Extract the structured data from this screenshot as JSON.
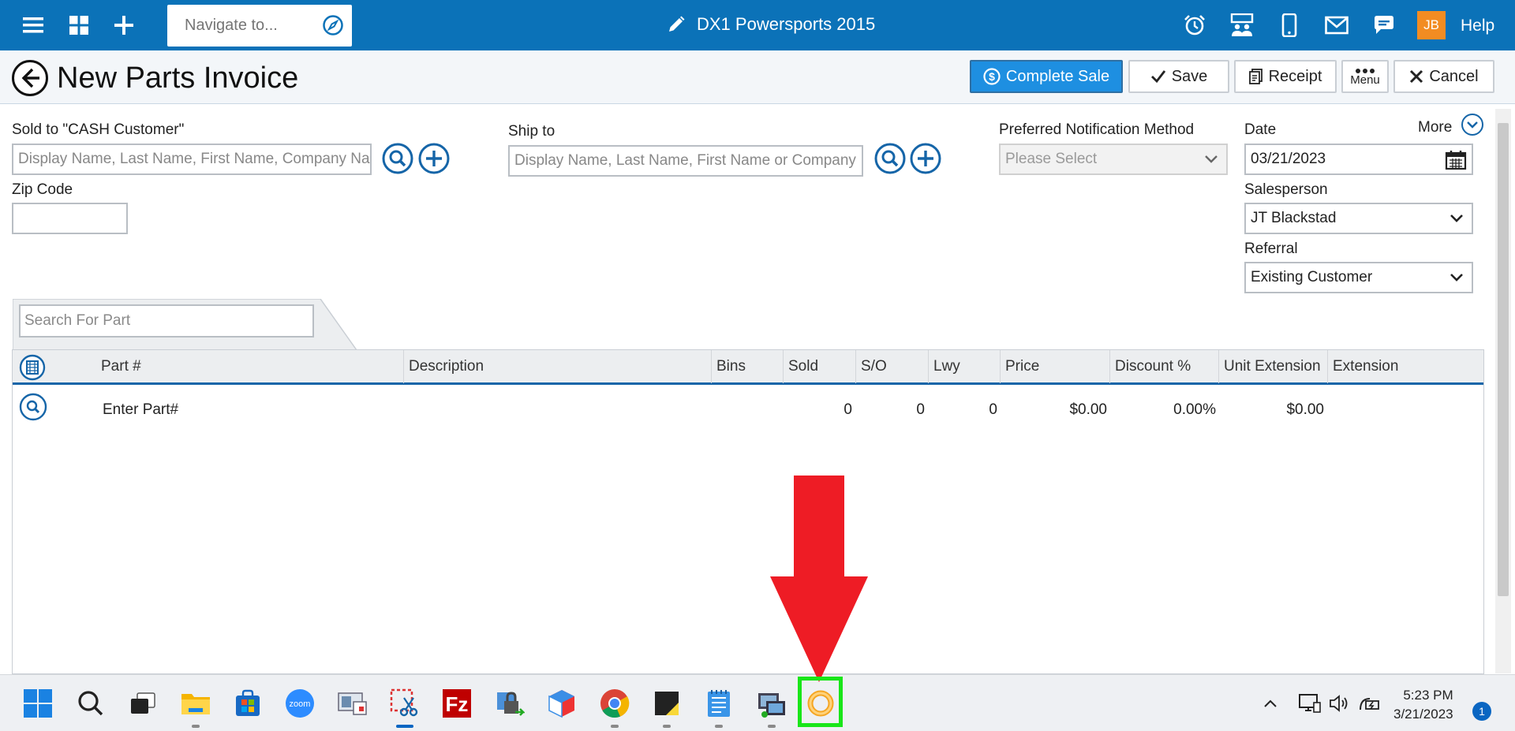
{
  "topbar": {
    "nav_placeholder": "Navigate to...",
    "title": "DX1 Powersports 2015",
    "user_initials": "JB",
    "help_label": "Help"
  },
  "header": {
    "title": "New Parts Invoice",
    "buttons": {
      "complete_sale": "Complete Sale",
      "save": "Save",
      "receipt": "Receipt",
      "menu": "Menu",
      "cancel": "Cancel"
    }
  },
  "form": {
    "sold_to_label": "Sold to  \"CASH Customer\"",
    "sold_to_placeholder": "Display Name, Last Name, First Name, Company Na",
    "zip_label": "Zip Code",
    "zip_value": "",
    "ship_to_label": "Ship to",
    "ship_to_placeholder": "Display Name, Last Name, First Name or Company",
    "notification_label": "Preferred Notification Method",
    "notification_value": "Please Select",
    "date_label": "Date",
    "more_label": "More",
    "date_value": "03/21/2023",
    "salesperson_label": "Salesperson",
    "salesperson_value": "JT Blackstad",
    "referral_label": "Referral",
    "referral_value": "Existing Customer"
  },
  "parts": {
    "search_placeholder": "Search For Part",
    "columns": [
      "Part #",
      "Description",
      "Bins",
      "Sold",
      "S/O",
      "Lwy",
      "Price",
      "Discount %",
      "Unit Extension",
      "Extension"
    ],
    "row": {
      "part": "Enter Part#",
      "sold": "0",
      "so": "0",
      "lwy": "0",
      "price": "$0.00",
      "discount": "0.00%",
      "unit_extension": "$0.00"
    }
  },
  "taskbar": {
    "time": "5:23 PM",
    "date": "3/21/2023",
    "notifications": "1"
  },
  "colors": {
    "topbar": "#0b72b8",
    "primary_button": "#1e8fe1",
    "accent": "#1565a8",
    "avatar": "#f28c22",
    "annotation_arrow": "#ee1c25",
    "annotation_box": "#19e619"
  }
}
